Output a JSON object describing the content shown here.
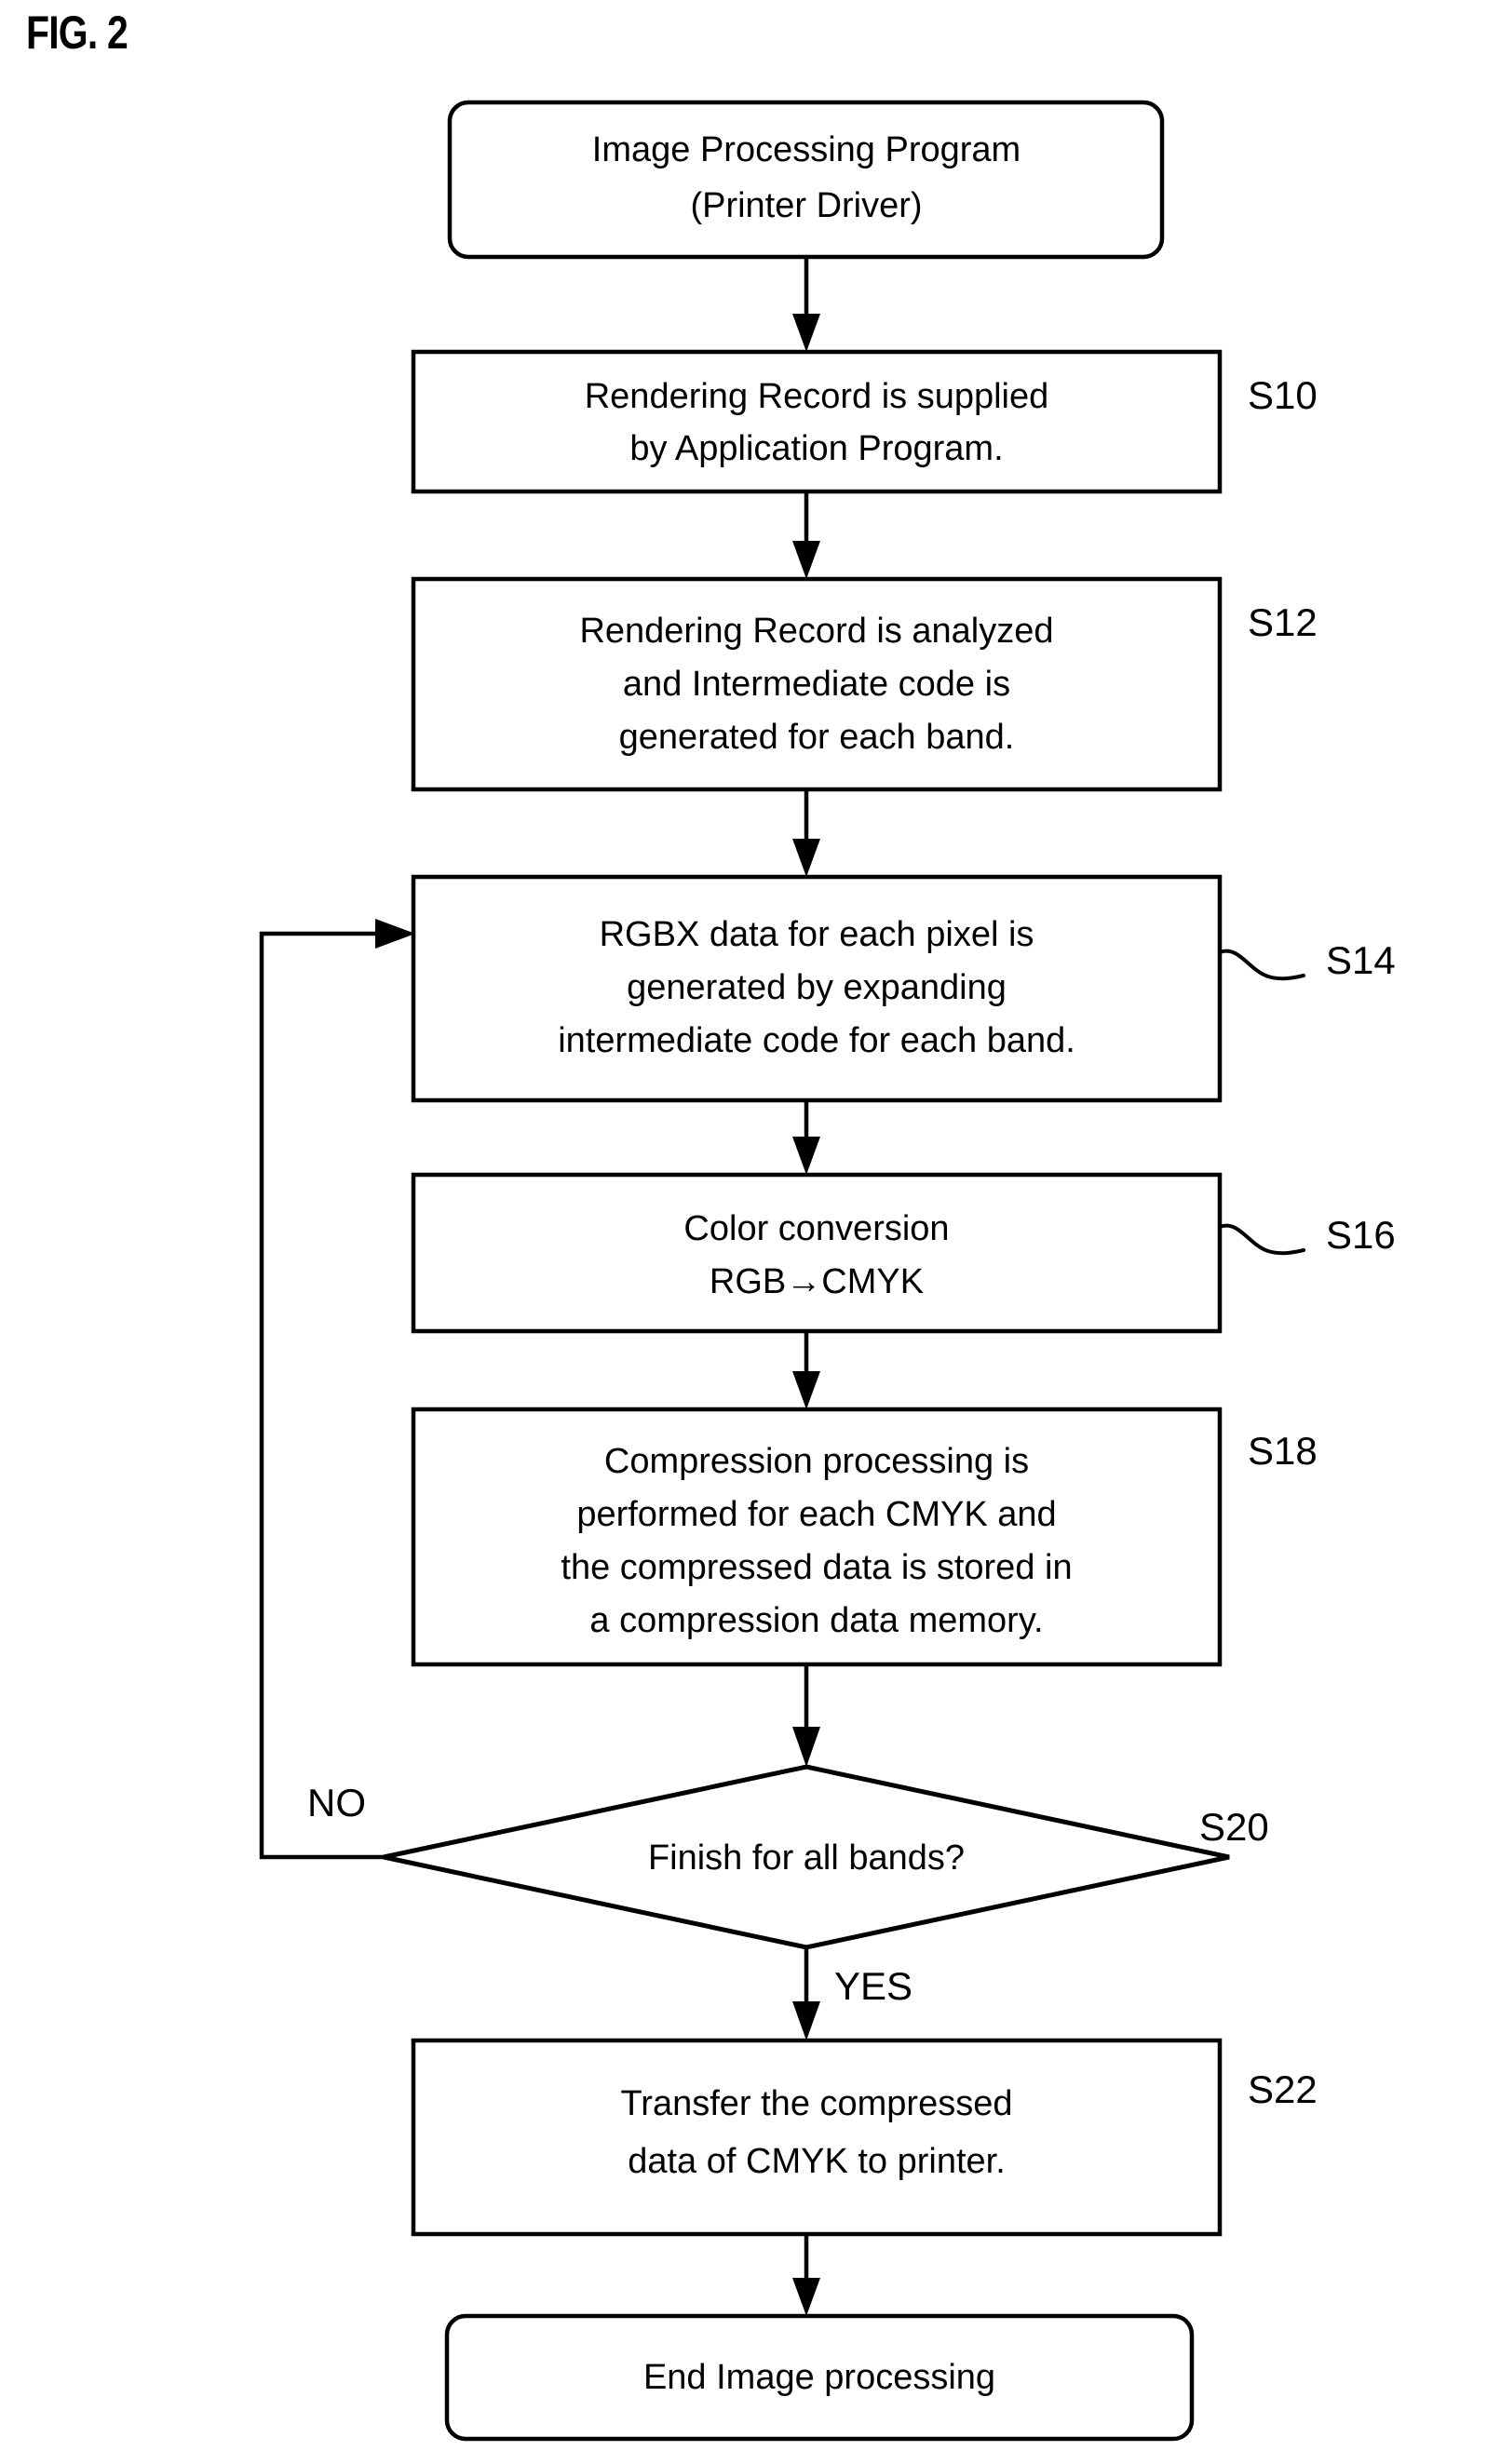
{
  "figure": {
    "title": "FIG. 2"
  },
  "flowchart": {
    "nodes": [
      {
        "id": "start",
        "type": "terminator",
        "step": "",
        "lines": [
          "Image Processing Program",
          "(Printer Driver)"
        ]
      },
      {
        "id": "s10",
        "type": "process",
        "step": "S10",
        "lines": [
          "Rendering Record is supplied",
          "by Application Program."
        ]
      },
      {
        "id": "s12",
        "type": "process",
        "step": "S12",
        "lines": [
          "Rendering Record is analyzed",
          "and Intermediate code is",
          "generated for each band."
        ]
      },
      {
        "id": "s14",
        "type": "process",
        "step": "S14",
        "lines": [
          "RGBX data for each pixel is",
          "generated by expanding",
          "intermediate code for each band."
        ]
      },
      {
        "id": "s16",
        "type": "process",
        "step": "S16",
        "lines": [
          "Color conversion",
          "RGB→CMYK"
        ]
      },
      {
        "id": "s18",
        "type": "process",
        "step": "S18",
        "lines": [
          "Compression processing is",
          "performed for each CMYK and",
          "the compressed data is stored in",
          "a compression data memory."
        ]
      },
      {
        "id": "s20",
        "type": "decision",
        "step": "S20",
        "lines": [
          "Finish for all bands?"
        ]
      },
      {
        "id": "s22",
        "type": "process",
        "step": "S22",
        "lines": [
          "Transfer the compressed",
          "data of CMYK to printer."
        ]
      },
      {
        "id": "end",
        "type": "terminator",
        "step": "",
        "lines": [
          "End Image processing"
        ]
      }
    ],
    "branches": {
      "no_label": "NO",
      "yes_label": "YES"
    }
  }
}
